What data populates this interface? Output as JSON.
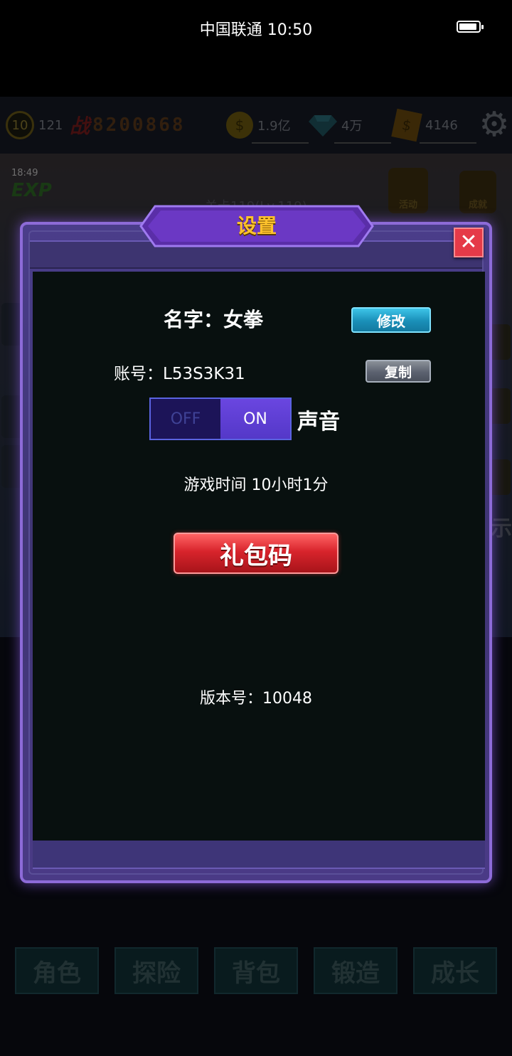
{
  "status_bar": {
    "carrier": "中国联通",
    "time": "10:50"
  },
  "game_hud": {
    "level": "10",
    "level_count": "121",
    "power_icon": "战",
    "power_value": "8200868",
    "gold": "1.9亿",
    "diamonds": "4万",
    "cash": "4146",
    "exp_timer": "18:49",
    "exp_label": "EXP",
    "stage": "关卡119(Lv.119)",
    "activity_label": "活动",
    "achievement_label": "成就",
    "show_label": "示"
  },
  "bottom_nav": [
    "角色",
    "探险",
    "背包",
    "锻造",
    "成长"
  ],
  "settings": {
    "title": "设置",
    "close_symbol": "✕",
    "name_text": "名字：女拳",
    "modify_button": "修改",
    "account_text": "账号：L53S3K31",
    "copy_button": "复制",
    "toggle_off": "OFF",
    "toggle_on": "ON",
    "sound_label": "声音",
    "sound_state": "on",
    "playtime_text": "游戏时间 10小时1分",
    "gift_code_button": "礼包码",
    "version_text": "版本号：10048"
  },
  "colors": {
    "title_gold": "#ffc22c",
    "modify_blue": "#1a8fb8",
    "gift_red": "#d8242c",
    "toggle_purple": "#5438c8",
    "close_red": "#e53a48"
  },
  "icons": [
    "battery-icon",
    "gear-icon",
    "coin-icon",
    "diamond-icon",
    "cash-icon",
    "close-icon"
  ]
}
